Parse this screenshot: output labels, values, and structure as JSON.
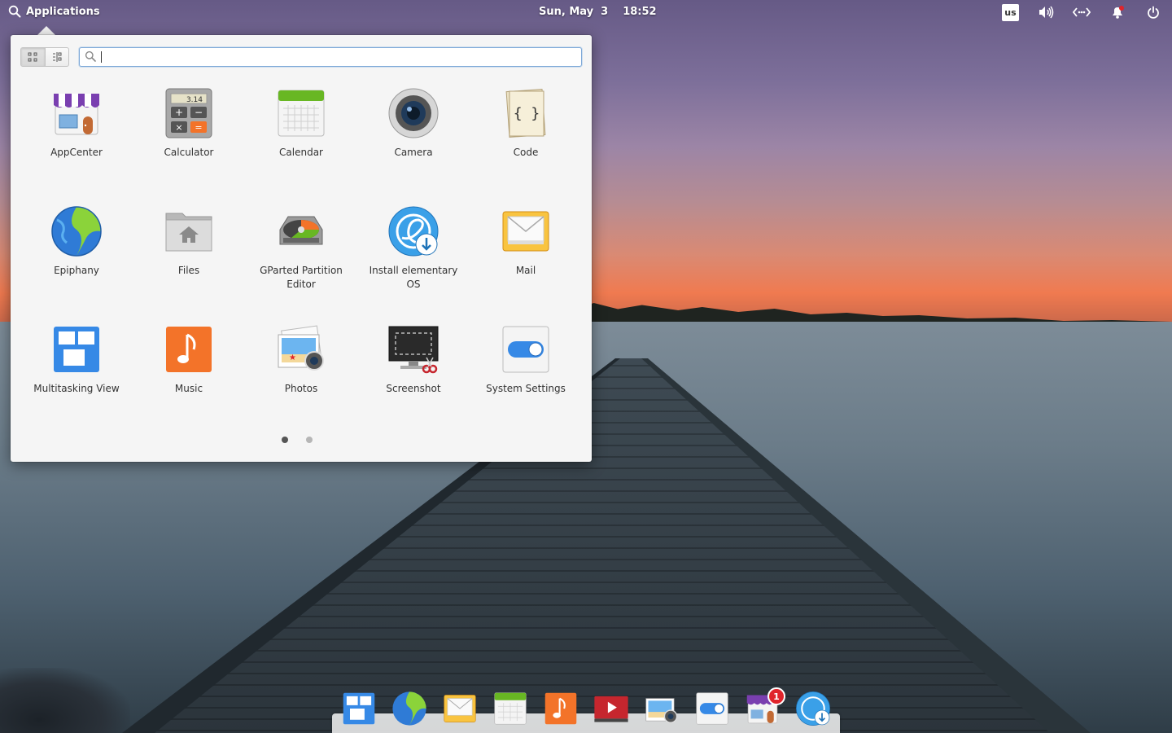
{
  "panel": {
    "applications_label": "Applications",
    "date": "Sun, May  3",
    "time": "18:52",
    "keyboard_layout": "us",
    "indicators": [
      "speaker-icon",
      "network-wired-icon",
      "notification-bell-icon",
      "power-icon"
    ]
  },
  "launcher": {
    "search": {
      "value": "",
      "placeholder": ""
    },
    "view_modes": [
      "grid-view",
      "category-view"
    ],
    "active_view": "grid-view",
    "apps": [
      {
        "label": "AppCenter",
        "icon": "appcenter-icon"
      },
      {
        "label": "Calculator",
        "icon": "calculator-icon"
      },
      {
        "label": "Calendar",
        "icon": "calendar-icon"
      },
      {
        "label": "Camera",
        "icon": "camera-icon"
      },
      {
        "label": "Code",
        "icon": "code-icon"
      },
      {
        "label": "Epiphany",
        "icon": "epiphany-icon"
      },
      {
        "label": "Files",
        "icon": "files-icon"
      },
      {
        "label": "GParted Partition Editor",
        "icon": "gparted-icon"
      },
      {
        "label": "Install elementary OS",
        "icon": "installer-icon"
      },
      {
        "label": "Mail",
        "icon": "mail-icon"
      },
      {
        "label": "Multitasking View",
        "icon": "multitasking-icon"
      },
      {
        "label": "Music",
        "icon": "music-icon"
      },
      {
        "label": "Photos",
        "icon": "photos-icon"
      },
      {
        "label": "Screenshot",
        "icon": "screenshot-icon"
      },
      {
        "label": "System Settings",
        "icon": "settings-icon"
      }
    ],
    "calculator_display": "3.14",
    "pages": 2,
    "current_page": 1
  },
  "dock": {
    "items": [
      {
        "icon": "multitasking-icon"
      },
      {
        "icon": "epiphany-icon"
      },
      {
        "icon": "mail-icon"
      },
      {
        "icon": "calendar-icon"
      },
      {
        "icon": "music-icon"
      },
      {
        "icon": "videos-icon"
      },
      {
        "icon": "photos-icon"
      },
      {
        "icon": "settings-icon"
      },
      {
        "icon": "appcenter-icon",
        "badge": "1"
      },
      {
        "icon": "installer-icon"
      }
    ]
  },
  "colors": {
    "accent": "#3689e6",
    "badge": "#e0242b",
    "launcher_bg": "#f5f5f5"
  }
}
